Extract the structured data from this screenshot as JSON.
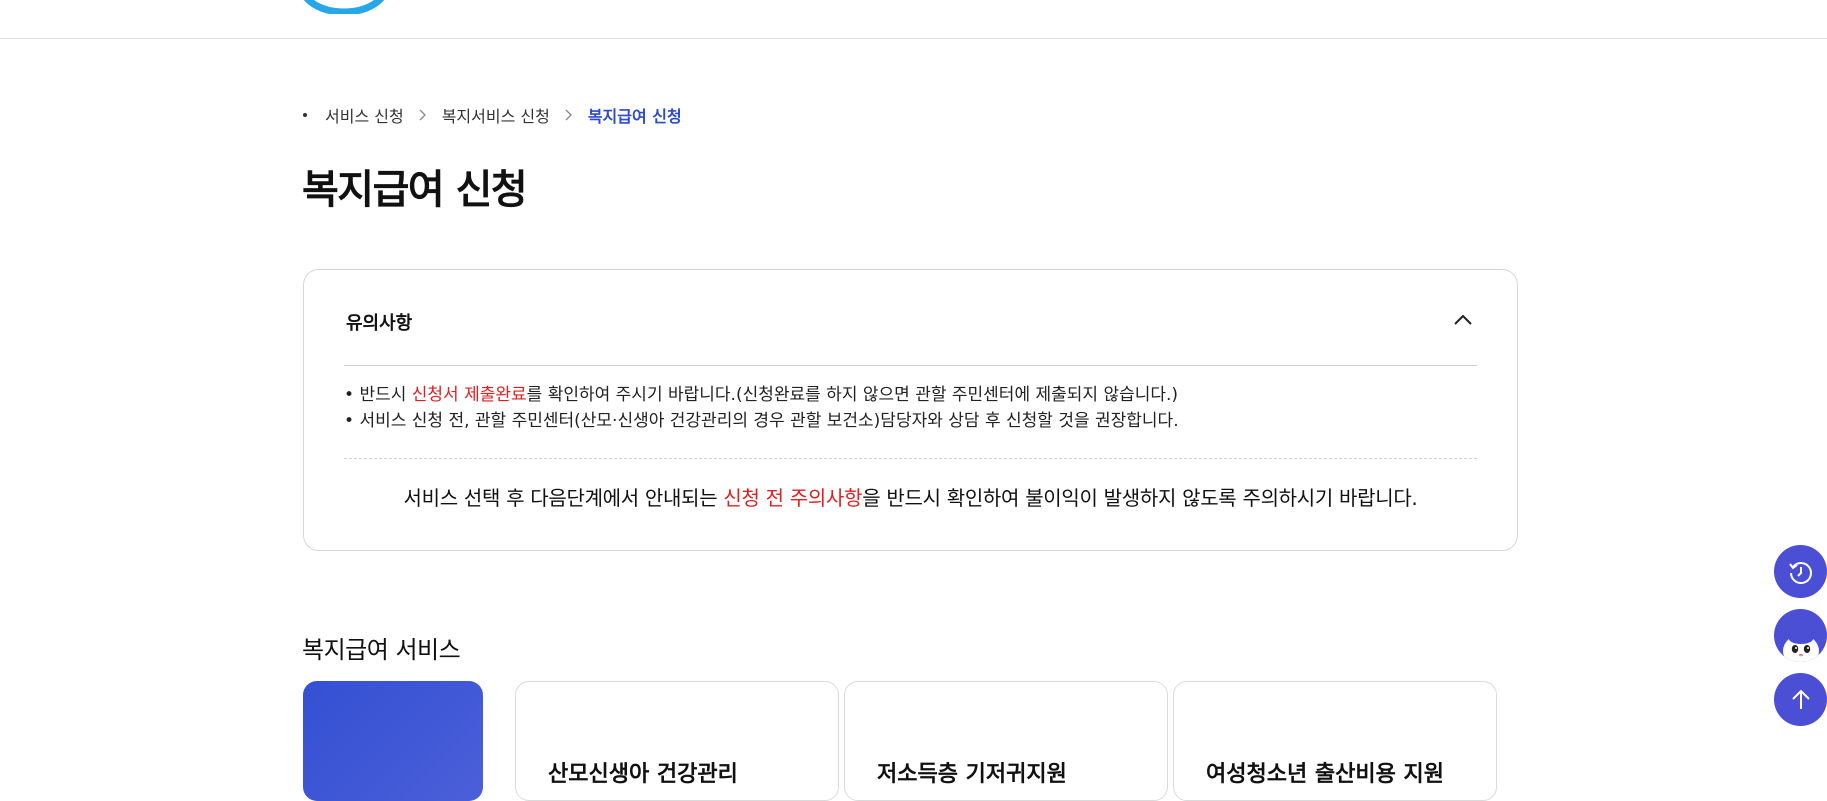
{
  "breadcrumb": {
    "items": [
      "서비스 신청",
      "복지서비스 신청"
    ],
    "current": "복지급여 신청"
  },
  "page_title": "복지급여 신청",
  "notice": {
    "title": "유의사항",
    "line1_before": "반드시 ",
    "line1_highlight": "신청서 제출완료",
    "line1_after": "를 확인하여 주시기 바랍니다.(신청완료를 하지 않으면 관할 주민센터에 제출되지 않습니다.)",
    "line2": "서비스 신청 전, 관할 주민센터(산모·신생아 건강관리의 경우 관할 보건소)담당자와 상담 후 신청할 것을 권장합니다.",
    "footer_before": "서비스 선택 후 다음단계에서 안내되는 ",
    "footer_highlight": "신청 전 주의사항",
    "footer_after": "을 반드시 확인하여 불이익이 발생하지 않도록 주의하시기 바랍니다."
  },
  "services": {
    "title": "복지급여 서비스",
    "cards": [
      "산모신생아 건강관리",
      "저소득층 기저귀지원",
      "여성청소년 출산비용 지원"
    ]
  },
  "colors": {
    "accent": "#2c4bd0",
    "highlight": "#e02020",
    "fab": "#4a4fd6"
  },
  "icons": {
    "history": "history-icon",
    "chatbot": "chatbot-icon",
    "top": "arrow-up-icon"
  }
}
